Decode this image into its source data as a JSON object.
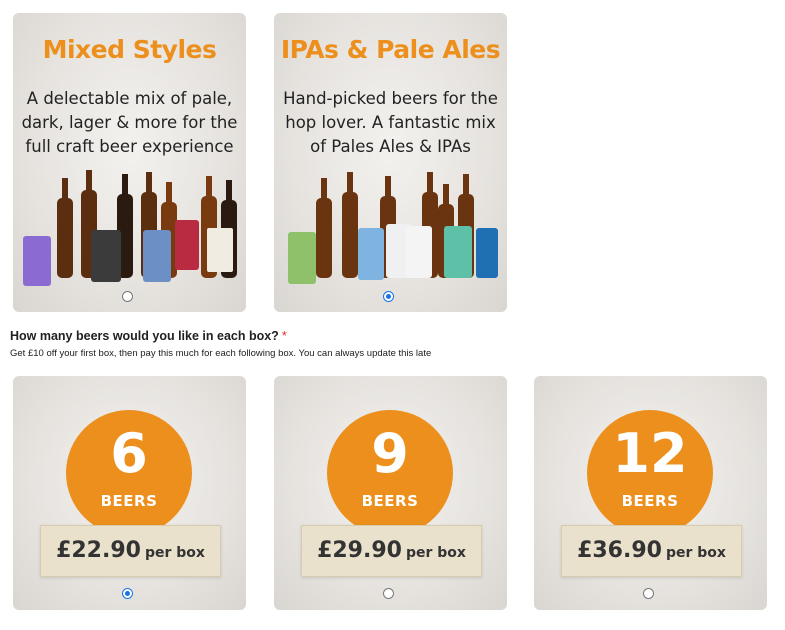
{
  "styles": [
    {
      "title": "Mixed Styles",
      "desc_lines": [
        "A delectable mix of pale,",
        "dark, lager & more for the",
        "full craft beer experience"
      ],
      "selected": false
    },
    {
      "title": "IPAs & Pale Ales",
      "desc_lines": [
        "Hand-picked beers for the",
        "hop lover. A fantastic mix",
        "of Pales Ales  & IPAs"
      ],
      "selected": true
    }
  ],
  "question": {
    "title": "How many beers would you like in each box?",
    "required_mark": "*",
    "hint": "Get £10 off your first box, then pay this much for each following box. You can always update this late"
  },
  "sizes": [
    {
      "count": "6",
      "unit": "BEERS",
      "price": "£22.90",
      "per": "per box",
      "selected": true
    },
    {
      "count": "9",
      "unit": "BEERS",
      "price": "£29.90",
      "per": "per box",
      "selected": false
    },
    {
      "count": "12",
      "unit": "BEERS",
      "price": "£36.90",
      "per": "per box",
      "selected": false
    }
  ],
  "colors": {
    "accent": "#ec8f1d",
    "radio_selected": "#1a73e8"
  }
}
